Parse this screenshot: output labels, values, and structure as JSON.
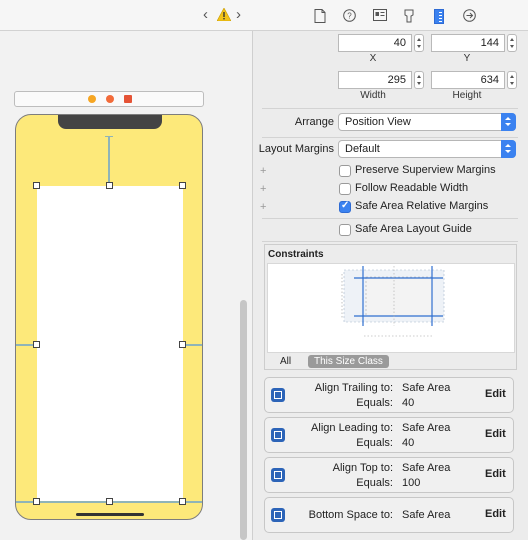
{
  "canvas": {
    "nav_back": "‹",
    "nav_forward": "›",
    "warning_icon": "warning-triangle-icon",
    "accent_color": "#fde97a"
  },
  "inspector": {
    "tabs": [
      "file-icon",
      "help-icon",
      "identity-icon",
      "attributes-icon",
      "size-icon",
      "connections-icon"
    ],
    "active_tab": "size-icon",
    "x_value": "40",
    "y_value": "144",
    "x_label": "X",
    "y_label": "Y",
    "width_value": "295",
    "height_value": "634",
    "width_label": "Width",
    "height_label": "Height",
    "arrange_label": "Arrange",
    "arrange_value": "Position View",
    "layout_margins_label": "Layout Margins",
    "layout_margins_value": "Default",
    "preserve_superview": "Preserve Superview Margins",
    "follow_readable": "Follow Readable Width",
    "safe_area_relative": "Safe Area Relative Margins",
    "safe_area_layout_guide": "Safe Area Layout Guide",
    "safe_area_relative_checked": true,
    "plus": "+"
  },
  "constraints": {
    "title": "Constraints",
    "filter_all": "All",
    "filter_size_class": "This Size Class",
    "items": [
      {
        "key1": "Align Trailing to:",
        "val1": "Safe Area",
        "key2": "Equals:",
        "val2": "40",
        "edit": "Edit",
        "icon": "align-trailing-icon"
      },
      {
        "key1": "Align Leading to:",
        "val1": "Safe Area",
        "key2": "Equals:",
        "val2": "40",
        "edit": "Edit",
        "icon": "align-leading-icon"
      },
      {
        "key1": "Align Top to:",
        "val1": "Safe Area",
        "key2": "Equals:",
        "val2": "100",
        "edit": "Edit",
        "icon": "align-top-icon"
      },
      {
        "key1": "Bottom Space to:",
        "val1": "Safe Area",
        "key2": "",
        "val2": "",
        "edit": "Edit",
        "icon": "bottom-space-icon"
      }
    ]
  }
}
